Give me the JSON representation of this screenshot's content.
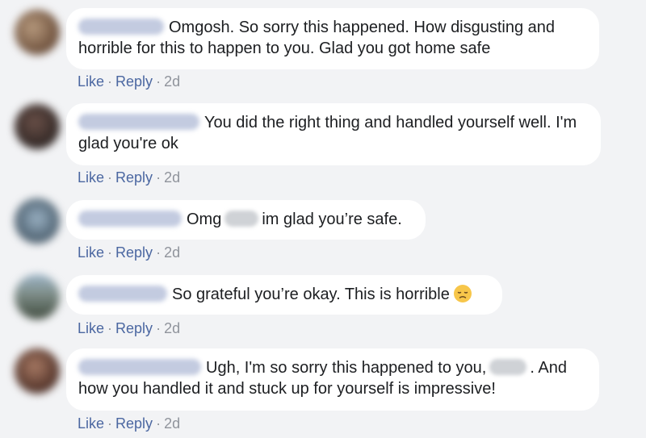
{
  "comments": [
    {
      "text_parts": [
        "Omgosh. So sorry this happened. How disgusting and horrible for this to happen to you. Glad you got home safe"
      ],
      "actions": {
        "like": "Like",
        "reply": "Reply",
        "time": "2d"
      },
      "avatar_color": "#8b6a52"
    },
    {
      "text_parts": [
        "You did the right thing and handled yourself well. I'm glad you're ok"
      ],
      "actions": {
        "like": "Like",
        "reply": "Reply",
        "time": "2d"
      },
      "avatar_color": "#4a3a36"
    },
    {
      "text_parts": [
        "Omg",
        "im glad you’re safe."
      ],
      "actions": {
        "like": "Like",
        "reply": "Reply",
        "time": "2d"
      },
      "avatar_color": "#6f8aa0"
    },
    {
      "text_parts": [
        "So grateful you’re okay. This is horrible"
      ],
      "actions": {
        "like": "Like",
        "reply": "Reply",
        "time": "2d"
      },
      "avatar_color": "#5f6d73",
      "emoji": "disappointed-face"
    },
    {
      "text_parts": [
        "Ugh, I'm so sorry this happened to you,",
        ". And how you handled it and stuck up for yourself is impressive!"
      ],
      "actions": {
        "like": "Like",
        "reply": "Reply",
        "time": "2d"
      },
      "avatar_color": "#6e4a3c"
    }
  ],
  "colors": {
    "background": "#f2f3f5",
    "bubble": "#ffffff",
    "link": "#4b67a1",
    "meta": "#90949c",
    "text": "#1c1e21",
    "redacted_name": "#c3cbe0"
  }
}
